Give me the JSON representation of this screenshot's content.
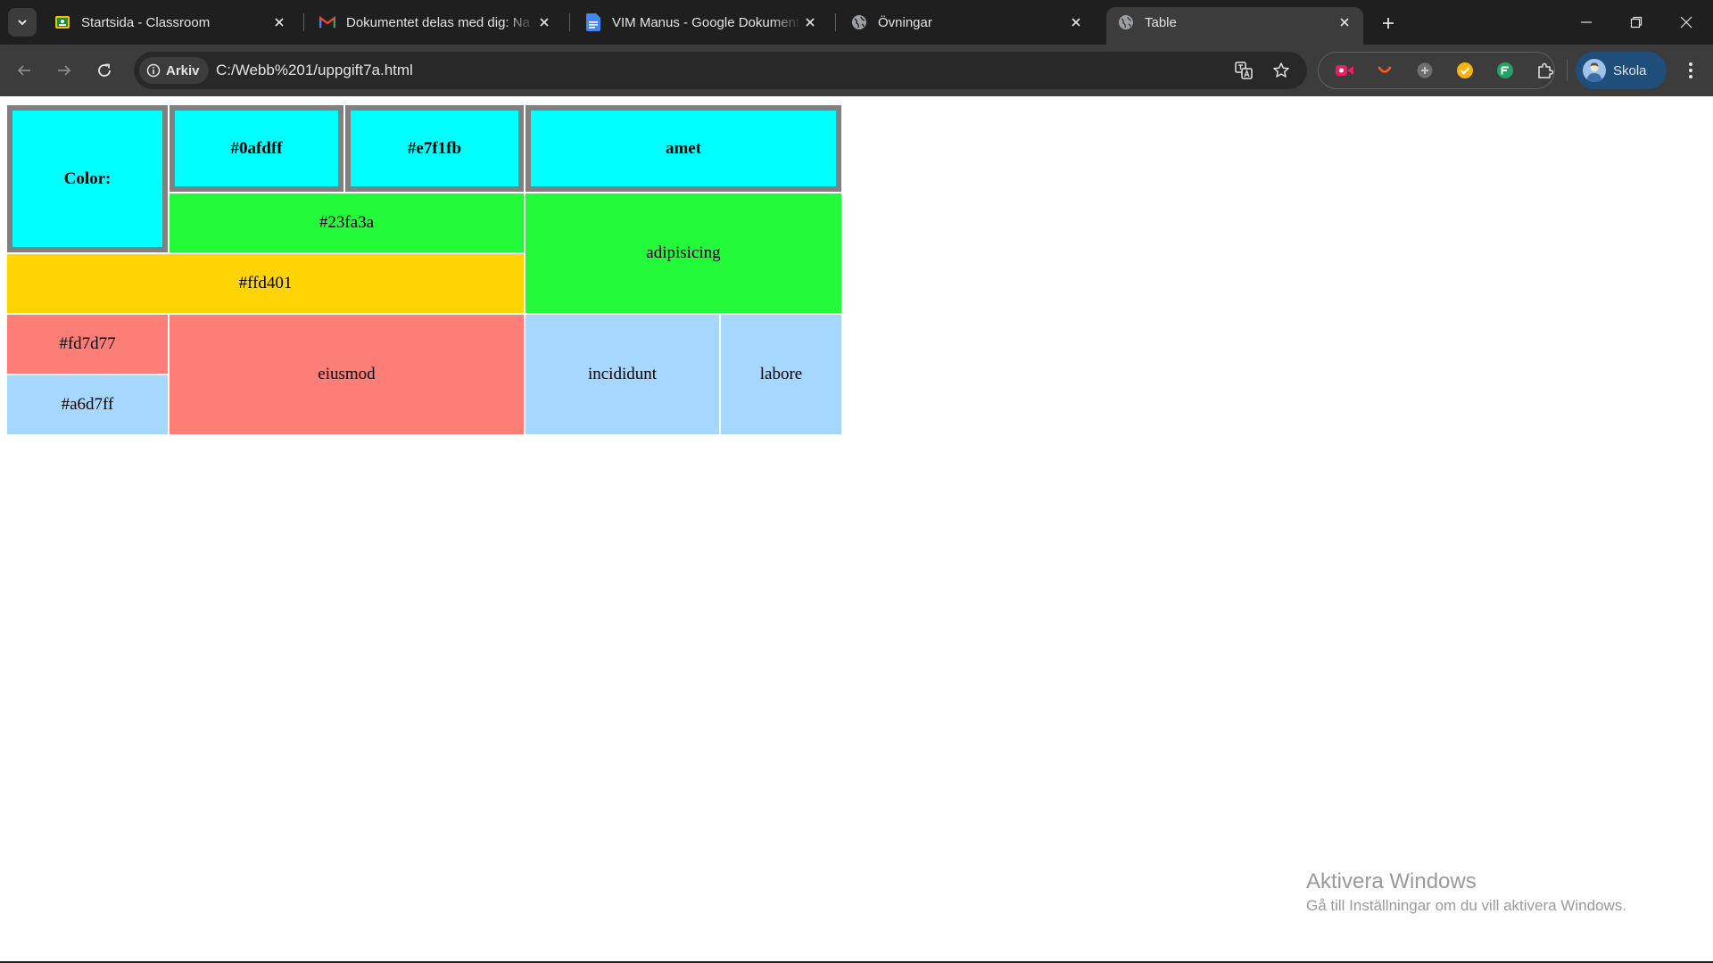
{
  "browser": {
    "tabs": [
      {
        "title": "Startsida - Classroom",
        "icon": "classroom-icon",
        "active": false
      },
      {
        "title": "Dokumentet delas med dig: Na",
        "icon": "gmail-icon",
        "active": false
      },
      {
        "title": "VIM Manus - Google Dokument",
        "icon": "docs-icon",
        "active": false
      },
      {
        "title": "Övningar",
        "icon": "globe-icon",
        "active": false
      },
      {
        "title": "Table",
        "icon": "globe-icon",
        "active": true
      }
    ],
    "chip_label": "Arkiv",
    "url": "C:/Webb%201/uppgift7a.html",
    "profile_name": "Skola"
  },
  "table": {
    "header": {
      "label": "Color:",
      "col1": "#0afdff",
      "col2": "#e7f1fb",
      "col3": "amet"
    },
    "cells": {
      "green_wide": "#23fa3a",
      "green_tall": "adipisicing",
      "yellow": "#ffd401",
      "red_small": "#fd7d77",
      "red_big": "eiusmod",
      "blue_small": "#a6d7ff",
      "blue_mid": "incididunt",
      "blue_right": "labore"
    }
  },
  "colors": {
    "header_bg": "#00ffff",
    "header_border": "#808080",
    "green": "#23fa3a",
    "yellow": "#ffd401",
    "red": "#fd7d77",
    "blue": "#a6d7ff",
    "chrome_dark": "#1f1f1f",
    "chrome_toolbar": "#3c3c3c"
  },
  "watermark": {
    "title": "Aktivera Windows",
    "subtitle": "Gå till Inställningar om du vill aktivera Windows."
  }
}
